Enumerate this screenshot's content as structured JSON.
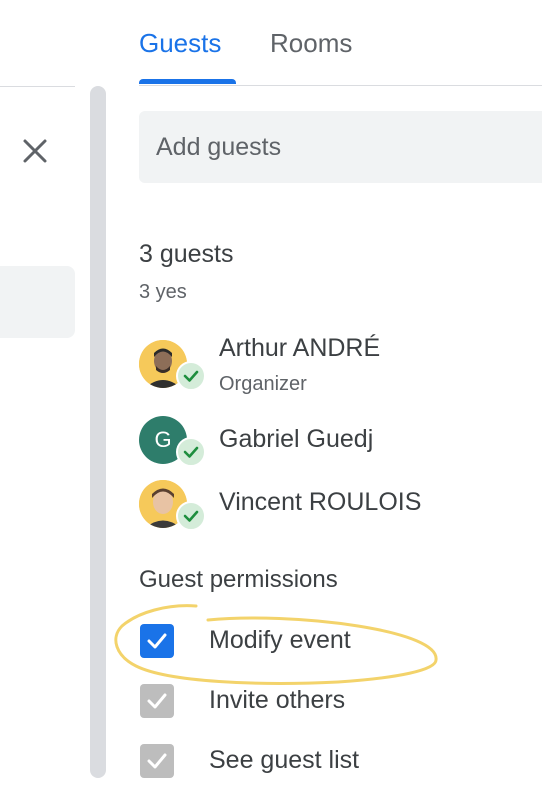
{
  "tabs": [
    {
      "label": "Guests",
      "active": true
    },
    {
      "label": "Rooms",
      "active": false
    }
  ],
  "add_guests": {
    "placeholder": "Add guests",
    "value": ""
  },
  "summary": {
    "count": "3 guests",
    "responses": "3 yes"
  },
  "guests": [
    {
      "name": "Arthur ANDRÉ",
      "role": "Organizer",
      "avatar": "photo",
      "status": "accepted-check-icon"
    },
    {
      "name": "Gabriel Guedj",
      "avatar_letter": "G",
      "status": "accepted-check-icon"
    },
    {
      "name": "Vincent ROULOIS",
      "avatar": "photo",
      "status": "accepted-check-icon"
    }
  ],
  "permissions": {
    "title": "Guest permissions",
    "items": [
      {
        "label": "Modify event",
        "checked": true
      },
      {
        "label": "Invite others",
        "checked": true,
        "disabled": true
      },
      {
        "label": "See guest list",
        "checked": true,
        "disabled": true
      }
    ]
  },
  "colors": {
    "accent": "#1a73e8",
    "check_green": "#1e8e3e",
    "highlight": "#f3d36b"
  },
  "icons": {
    "close": "close-icon",
    "check": "check-icon"
  }
}
